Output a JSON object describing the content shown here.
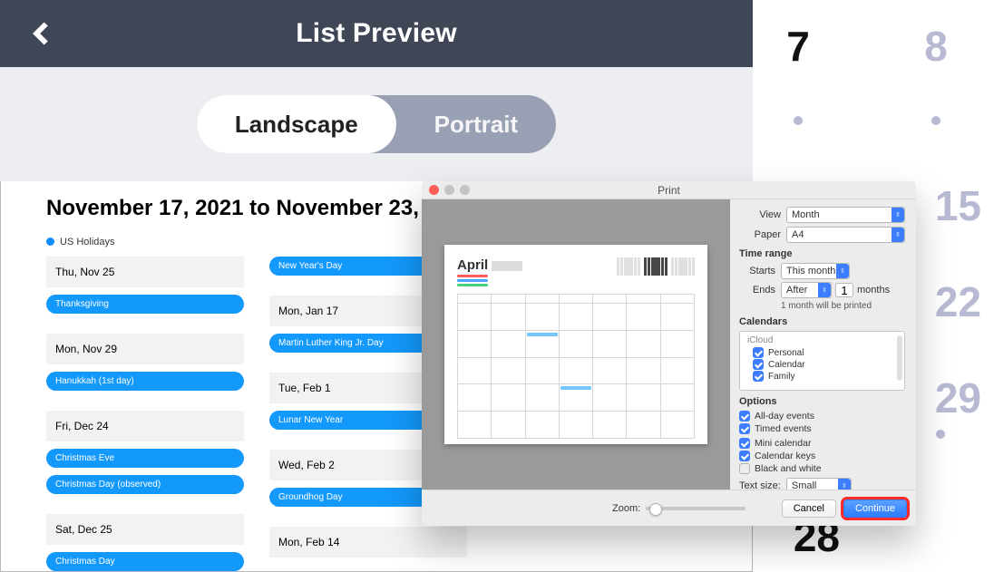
{
  "ios": {
    "header_title": "List Preview",
    "segments": {
      "landscape": "Landscape",
      "portrait": "Portrait",
      "active": "landscape"
    },
    "doc": {
      "title": "November 17, 2021 to November 23,",
      "calendar_tag": "US Holidays",
      "col1": [
        {
          "t": "date",
          "v": "Thu, Nov 25"
        },
        {
          "t": "ev",
          "v": "Thanksgiving"
        },
        {
          "t": "gap"
        },
        {
          "t": "date",
          "v": "Mon, Nov 29"
        },
        {
          "t": "ev",
          "v": "Hanukkah (1st day)"
        },
        {
          "t": "gap"
        },
        {
          "t": "date",
          "v": "Fri, Dec 24"
        },
        {
          "t": "ev",
          "v": "Christmas Eve"
        },
        {
          "t": "ev",
          "v": "Christmas Day (observed)"
        },
        {
          "t": "gap"
        },
        {
          "t": "date",
          "v": "Sat, Dec 25"
        },
        {
          "t": "ev",
          "v": "Christmas Day"
        }
      ],
      "col2": [
        {
          "t": "ev",
          "v": "New Year's Day"
        },
        {
          "t": "gap"
        },
        {
          "t": "date",
          "v": "Mon, Jan 17"
        },
        {
          "t": "ev",
          "v": "Martin Luther King Jr. Day"
        },
        {
          "t": "gap"
        },
        {
          "t": "date",
          "v": "Tue, Feb 1"
        },
        {
          "t": "ev",
          "v": "Lunar New Year"
        },
        {
          "t": "gap"
        },
        {
          "t": "date",
          "v": "Wed, Feb 2"
        },
        {
          "t": "ev",
          "v": "Groundhog Day"
        },
        {
          "t": "gap"
        },
        {
          "t": "date",
          "v": "Mon, Feb 14"
        }
      ]
    }
  },
  "mac": {
    "dialog_title": "Print",
    "view_label": "View",
    "view_value": "Month",
    "paper_label": "Paper",
    "paper_value": "A4",
    "section_time_range": "Time range",
    "starts_label": "Starts",
    "starts_value": "This month",
    "ends_label": "Ends",
    "ends_value": "After",
    "ends_num": "1",
    "ends_unit": "months",
    "hint": "1 month will be printed",
    "section_calendars": "Calendars",
    "cal_group": "iCloud",
    "cal_items": [
      "Personal",
      "Calendar",
      "Family"
    ],
    "section_options": "Options",
    "opt_allday": "All-day events",
    "opt_timed": "Timed events",
    "opt_mini": "Mini calendar",
    "opt_keys": "Calendar keys",
    "opt_bw": "Black and white",
    "textsize_label": "Text size:",
    "textsize_value": "Small",
    "zoom_label": "Zoom:",
    "cancel": "Cancel",
    "continue": "Continue",
    "preview_month": "April",
    "traffic": {
      "close": "#ff5f57",
      "min": "#c4c4c4",
      "max": "#c4c4c4"
    }
  },
  "bg_calendar": {
    "row1": [
      {
        "n": "7",
        "dark": true
      },
      {
        "n": "8",
        "dark": false
      }
    ],
    "mid": [
      "15",
      "22",
      "29"
    ],
    "big28": "28"
  }
}
